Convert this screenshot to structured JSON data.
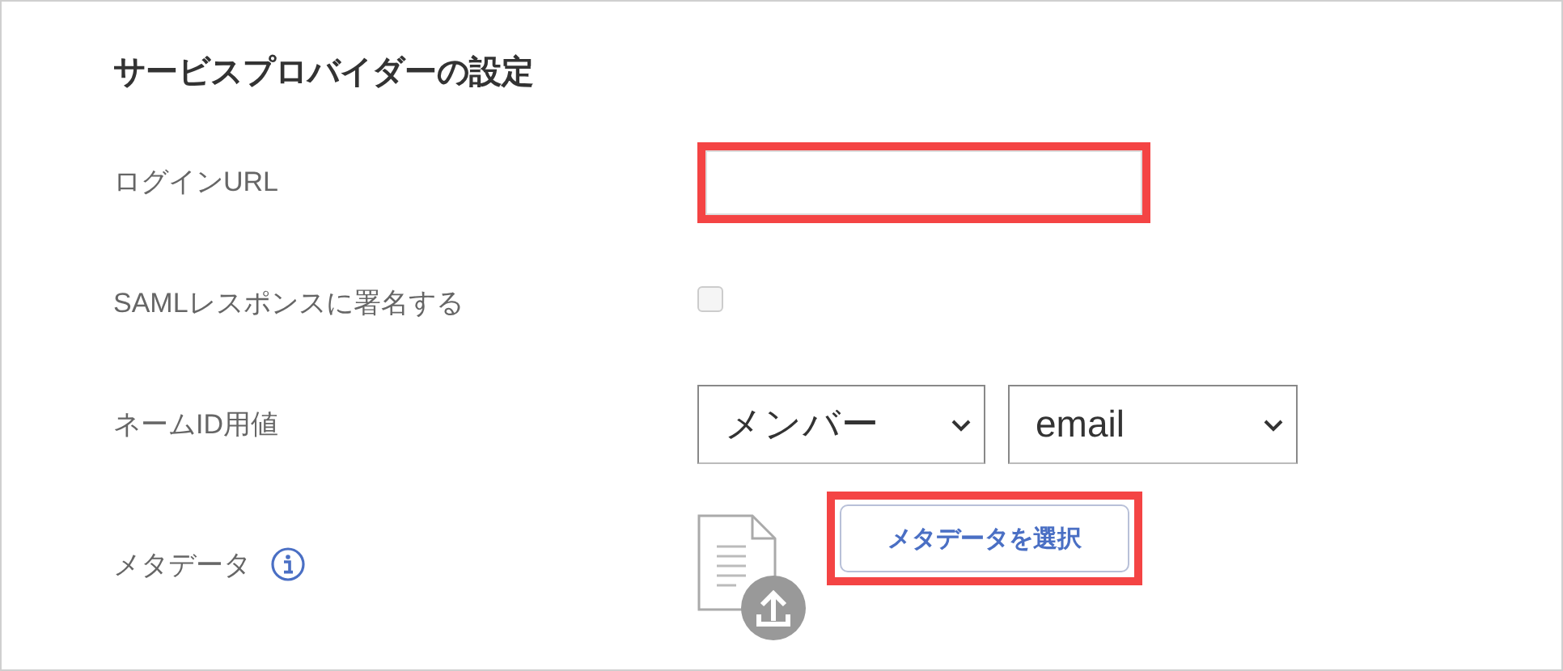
{
  "section": {
    "title": "サービスプロバイダーの設定"
  },
  "fields": [
    {
      "kind": "text",
      "label": "ログインURL",
      "highlighted": true
    },
    {
      "kind": "checkbox",
      "label": "SAMLレスポンスに署名する",
      "checked": false
    },
    {
      "kind": "selects",
      "label": "ネームID用値",
      "selects": [
        {
          "value": "メンバー"
        },
        {
          "value": "email"
        }
      ]
    },
    {
      "kind": "file",
      "label": "メタデータ",
      "info": true,
      "button": "メタデータを選択",
      "highlighted": true
    }
  ]
}
